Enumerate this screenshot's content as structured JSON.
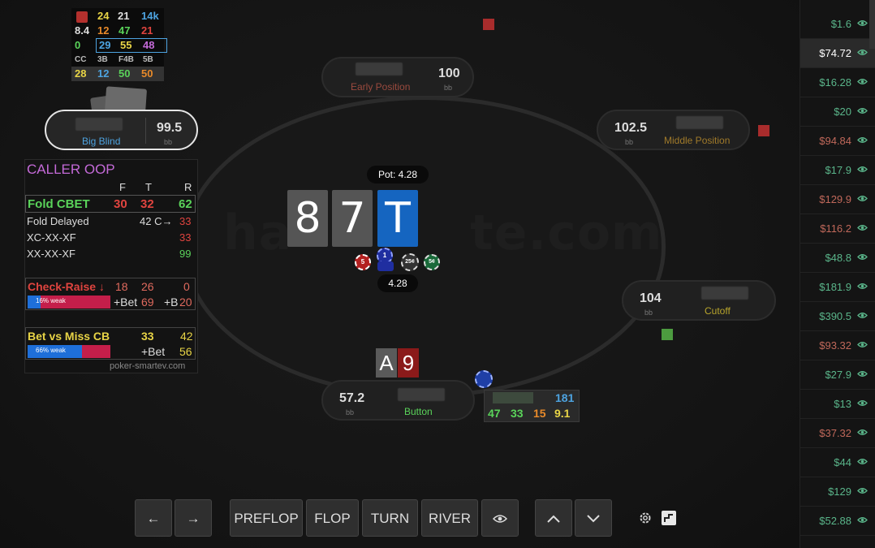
{
  "colors": {
    "red": "#e0443f",
    "green": "#5ad35a",
    "yellow": "#e8d446",
    "blue": "#4da3e0",
    "purple": "#c46ad8",
    "orange": "#e88a2a",
    "accent_card": "#1565c0"
  },
  "hud": {
    "row1": [
      "24",
      "21",
      "14k"
    ],
    "row2": [
      "8.4",
      "12",
      "47",
      "21"
    ],
    "row3": [
      "0",
      "29",
      "55",
      "48"
    ],
    "row4": [
      "CC",
      "3B",
      "F4B",
      "5B"
    ],
    "row5": [
      "28",
      "12",
      "50",
      "50"
    ]
  },
  "seats": {
    "early": {
      "stack": "100",
      "unit": "bb",
      "position": "Early Position"
    },
    "big_blind": {
      "stack": "99.5",
      "unit": "bb",
      "position": "Big Blind"
    },
    "middle": {
      "stack": "102.5",
      "unit": "bb",
      "position": "Middle Position"
    },
    "cutoff": {
      "stack": "104",
      "unit": "bb",
      "position": "Cutoff"
    },
    "button": {
      "stack": "57.2",
      "unit": "bb",
      "position": "Button"
    }
  },
  "pot": {
    "label": "Pot: 4.28",
    "amount": "4.28"
  },
  "board": [
    "8",
    "7",
    "T"
  ],
  "hero_cards": [
    "A",
    "9"
  ],
  "chips": [
    "5",
    "1",
    "25¢",
    "5¢"
  ],
  "button_hud": {
    "top": "181",
    "vals": [
      "47",
      "33",
      "15",
      "9.1"
    ]
  },
  "panel": {
    "title": "CALLER OOP",
    "cols": [
      "F",
      "T",
      "R"
    ],
    "fold_cbet": {
      "label": "Fold CBET",
      "f": "30",
      "t": "32",
      "r": "62"
    },
    "fold_delayed": {
      "label": "Fold Delayed",
      "t": "42 C→",
      "r": "33"
    },
    "xc": {
      "label": "XC-XX-XF",
      "r": "33"
    },
    "xx": {
      "label": "XX-XX-XF",
      "r": "99"
    },
    "check_raise": {
      "label": "Check-Raise ↓",
      "f": "18",
      "t": "26",
      "r": "0",
      "bar": "16% weak",
      "bet": "+Bet",
      "bet_val": "69",
      "b": "+B",
      "b_val": "20"
    },
    "bet_vs_miss": {
      "label": "Bet vs Miss CB",
      "t": "33",
      "r": "42",
      "bar": "66% weak",
      "bet": "+Bet",
      "bet_val": "56"
    },
    "footer": "poker-smartev.com"
  },
  "controls": {
    "prev": "←",
    "next": "→",
    "preflop": "PREFLOP",
    "flop": "FLOP",
    "turn": "TURN",
    "river": "RIVER"
  },
  "sidebar": [
    {
      "v": "$1.6",
      "c": "g"
    },
    {
      "v": "$74.72",
      "c": "w"
    },
    {
      "v": "$16.28",
      "c": "g"
    },
    {
      "v": "$20",
      "c": "g"
    },
    {
      "v": "$94.84",
      "c": "r"
    },
    {
      "v": "$17.9",
      "c": "g"
    },
    {
      "v": "$129.9",
      "c": "r"
    },
    {
      "v": "$116.2",
      "c": "r"
    },
    {
      "v": "$48.8",
      "c": "g"
    },
    {
      "v": "$181.9",
      "c": "g"
    },
    {
      "v": "$390.5",
      "c": "g"
    },
    {
      "v": "$93.32",
      "c": "r"
    },
    {
      "v": "$27.9",
      "c": "g"
    },
    {
      "v": "$13",
      "c": "g"
    },
    {
      "v": "$37.32",
      "c": "r"
    },
    {
      "v": "$44",
      "c": "g"
    },
    {
      "v": "$129",
      "c": "g"
    },
    {
      "v": "$52.88",
      "c": "g"
    }
  ]
}
